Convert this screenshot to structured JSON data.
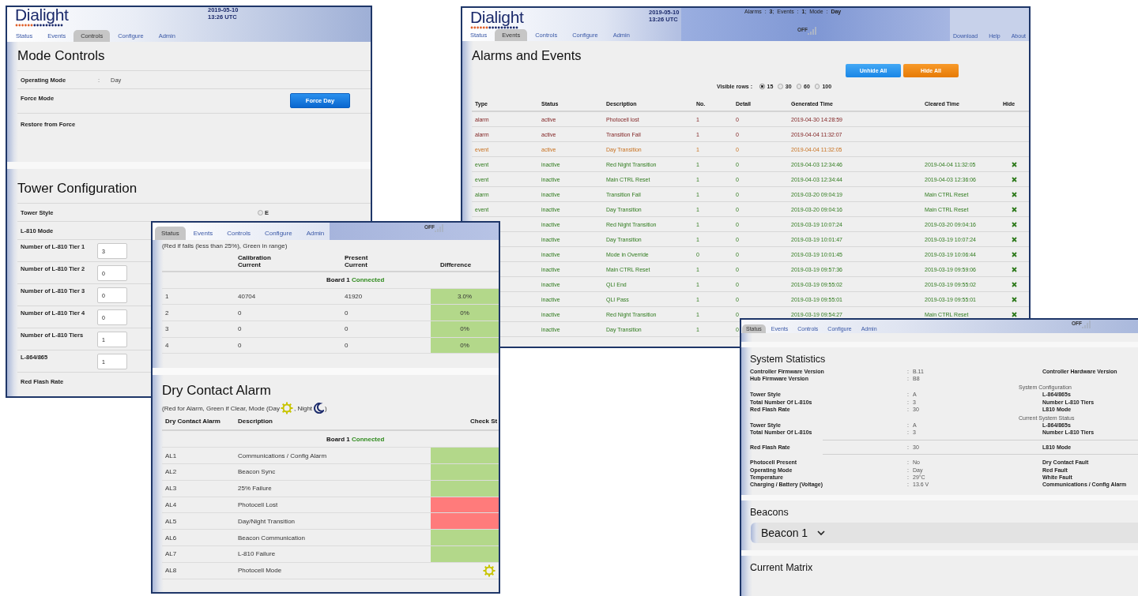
{
  "controls_window": {
    "logo": "Dialight",
    "date": "2019-05-10",
    "time": "13:26  UTC",
    "tabs": [
      {
        "label": "Status",
        "selected": false
      },
      {
        "label": "Events",
        "selected": false
      },
      {
        "label": "Controls",
        "selected": true
      },
      {
        "label": "Configure",
        "selected": false
      },
      {
        "label": "Admin",
        "selected": false
      }
    ],
    "mode_controls": {
      "title": "Mode Controls",
      "rows": [
        {
          "kind": "value",
          "label": "Operating Mode",
          "colon": ":",
          "value": "Day"
        },
        {
          "kind": "button",
          "label": "Force Mode",
          "button": "Force Day"
        },
        {
          "kind": "plain",
          "label": "Restore from Force"
        }
      ]
    },
    "tower_configuration": {
      "title": "Tower Configuration",
      "rows": [
        {
          "kind": "radio",
          "label": "Tower Style",
          "option": "E",
          "selected": false
        },
        {
          "kind": "plain",
          "label": "L-810 Mode"
        },
        {
          "kind": "input",
          "label": "Number of L-810 Tier 1",
          "value": "3"
        },
        {
          "kind": "input",
          "label": "Number of L-810 Tier 2",
          "value": "0"
        },
        {
          "kind": "input",
          "label": "Number of L-810 Tier 3",
          "value": "0"
        },
        {
          "kind": "input",
          "label": "Number of L-810 Tier 4",
          "value": "0"
        },
        {
          "kind": "input",
          "label": "Number of L-810 Tiers",
          "value": "1"
        },
        {
          "kind": "input",
          "label": "L-864/865",
          "value": "1"
        },
        {
          "kind": "plain",
          "label": "Red Flash Rate"
        }
      ]
    }
  },
  "events_window": {
    "logo": "Dialight",
    "date": "2019-05-10",
    "time": "13:26  UTC",
    "summary": "Alarms  :  **3**;  Events  :  **1**;  Mode  :  **Day**",
    "signal_label": "OFF",
    "tabs": [
      {
        "label": "Status",
        "selected": false
      },
      {
        "label": "Events",
        "selected": true
      },
      {
        "label": "Controls",
        "selected": false
      },
      {
        "label": "Configure",
        "selected": false
      },
      {
        "label": "Admin",
        "selected": false
      }
    ],
    "links": [
      "Download",
      "Help",
      "About"
    ],
    "title": "Alarms and Events",
    "buttons": [
      {
        "kind": "unhide",
        "label": "Unhide All"
      },
      {
        "kind": "hide",
        "label": "Hide All"
      }
    ],
    "visible_rows": {
      "label": "Visible rows :",
      "options": [
        {
          "label": "15",
          "selected": true
        },
        {
          "label": "30",
          "selected": false
        },
        {
          "label": "60",
          "selected": false
        },
        {
          "label": "100",
          "selected": false
        }
      ]
    },
    "table": {
      "columns": [
        "Type",
        "Status",
        "Description",
        "No.",
        "Detail",
        "Generated Time",
        "Cleared Time",
        "Hide"
      ],
      "rows": [
        {
          "type": "alarm",
          "status": "active",
          "description": "Photocell lost",
          "no": "1",
          "detail": "0",
          "generated": "2019-04-30 14:28:59",
          "hideable": false
        },
        {
          "type": "alarm",
          "status": "active",
          "description": "Transition Fail",
          "no": "1",
          "detail": "0",
          "generated": "2019-04-04 11:32:07",
          "hideable": false
        },
        {
          "type": "event",
          "status": "active",
          "description": "Day Transition",
          "no": "1",
          "detail": "0",
          "generated": "2019-04-04 11:32:05",
          "hideable": false
        },
        {
          "type": "event",
          "status": "inactive",
          "description": "Red Night Transition",
          "no": "1",
          "detail": "0",
          "generated": "2019-04-03 12:34:46",
          "cleared": "2019-04-04 11:32:05",
          "hideable": true
        },
        {
          "type": "event",
          "status": "inactive",
          "description": "Main CTRL Reset",
          "no": "1",
          "detail": "0",
          "generated": "2019-04-03 12:34:44",
          "cleared": "2019-04-03 12:36:06",
          "hideable": true
        },
        {
          "type": "alarm",
          "status": "inactive",
          "description": "Transition Fail",
          "no": "1",
          "detail": "0",
          "generated": "2019-03-20 09:04:19",
          "cleared": "Main CTRL Reset",
          "hideable": true
        },
        {
          "type": "event",
          "status": "inactive",
          "description": "Day Transition",
          "no": "1",
          "detail": "0",
          "generated": "2019-03-20 09:04:16",
          "cleared": "Main CTRL Reset",
          "hideable": true
        },
        {
          "status": "inactive",
          "description": "Red Night Transition",
          "no": "1",
          "detail": "0",
          "generated": "2019-03-19 10:07:24",
          "cleared": "2019-03-20 09:04:16",
          "hideable": true
        },
        {
          "status": "inactive",
          "description": "Day Transition",
          "no": "1",
          "detail": "0",
          "generated": "2019-03-19 10:01:47",
          "cleared": "2019-03-19 10:07:24",
          "hideable": true
        },
        {
          "status": "inactive",
          "description": "Mode in Override",
          "no": "0",
          "detail": "0",
          "generated": "2019-03-19 10:01:45",
          "cleared": "2019-03-19 10:06:44",
          "hideable": true
        },
        {
          "status": "inactive",
          "description": "Main CTRL Reset",
          "no": "1",
          "detail": "0",
          "generated": "2019-03-19 09:57:36",
          "cleared": "2019-03-19 09:59:06",
          "hideable": true
        },
        {
          "status": "inactive",
          "description": "QLI End",
          "no": "1",
          "detail": "0",
          "generated": "2019-03-19 09:55:02",
          "cleared": "2019-03-19 09:55:02",
          "hideable": true
        },
        {
          "status": "inactive",
          "description": "QLI Pass",
          "no": "1",
          "detail": "0",
          "generated": "2019-03-19 09:55:01",
          "cleared": "2019-03-19 09:55:01",
          "hideable": true
        },
        {
          "status": "inactive",
          "description": "Red Night Transition",
          "no": "1",
          "detail": "0",
          "generated": "2019-03-19 09:54:27",
          "cleared": "Main CTRL Reset",
          "hideable": true
        },
        {
          "status": "inactive",
          "description": "Day Transition",
          "no": "1",
          "detail": "0"
        }
      ]
    }
  },
  "status_window": {
    "signal_label": "OFF",
    "tabs": [
      {
        "label": "Status",
        "selected": true
      },
      {
        "label": "Events",
        "selected": false
      },
      {
        "label": "Controls",
        "selected": false
      },
      {
        "label": "Configure",
        "selected": false
      },
      {
        "label": "Admin",
        "selected": false
      }
    ],
    "matrix": {
      "note": "(Red if fails (less than 25%), Green in range)",
      "columns": [
        "Calibration Current",
        "Present Current",
        "Difference"
      ],
      "board": {
        "label": "Board 1",
        "status": "Connected"
      },
      "rows": [
        {
          "index": "1",
          "calibration": "40704",
          "present": "41920",
          "difference": "3.0%",
          "color": "#b3d88a"
        },
        {
          "index": "2",
          "calibration": "0",
          "present": "0",
          "difference": "0%",
          "color": "#b3d88a"
        },
        {
          "index": "3",
          "calibration": "0",
          "present": "0",
          "difference": "0%",
          "color": "#b3d88a"
        },
        {
          "index": "4",
          "calibration": "0",
          "present": "0",
          "difference": "0%",
          "color": "#b3d88a"
        }
      ]
    },
    "dry_contact": {
      "title": "Dry Contact Alarm",
      "legend": [
        "(Red for Alarm, Green if Clear, Mode (Day",
        ", Night",
        ")"
      ],
      "columns": [
        "Dry Contact Alarm",
        "Description",
        "Check St"
      ],
      "board": {
        "label": "Board 1",
        "status": "Connected"
      },
      "rows": [
        {
          "kind": "status",
          "id": "AL1",
          "description": "Communications / Config Alarm",
          "color": "#b3d88a"
        },
        {
          "kind": "status",
          "id": "AL2",
          "description": "Beacon Sync",
          "color": "#b3d88a"
        },
        {
          "kind": "status",
          "id": "AL3",
          "description": "25% Failure",
          "color": "#b3d88a"
        },
        {
          "kind": "status",
          "id": "AL4",
          "description": "Photocell Lost",
          "color": "#ff7b7b"
        },
        {
          "kind": "status",
          "id": "AL5",
          "description": "Day/Night Transition",
          "color": "#ff7b7b"
        },
        {
          "kind": "status",
          "id": "AL6",
          "description": "Beacon Communication",
          "color": "#b3d88a"
        },
        {
          "kind": "status",
          "id": "AL7",
          "description": "L-810 Failure",
          "color": "#b3d88a"
        },
        {
          "kind": "day_mode",
          "id": "AL8",
          "description": "Photocell Mode"
        }
      ]
    }
  },
  "statistics_window": {
    "signal_label": "OFF",
    "tabs": [
      {
        "label": "Status",
        "selected": true
      },
      {
        "label": "Events",
        "selected": false
      },
      {
        "label": "Controls",
        "selected": false
      },
      {
        "label": "Configure",
        "selected": false
      },
      {
        "label": "Admin",
        "selected": false
      }
    ],
    "title": "System Statistics",
    "groups": [
      {
        "ruled": false,
        "rows": [
          {
            "label": "Controller Firmware Version",
            "colon": ":",
            "value": "B.11",
            "right_label": "Controller Hardware Version"
          },
          {
            "label": "Hub Firmware Version",
            "colon": ":",
            "value": "B8"
          }
        ]
      },
      {
        "heading": "System Configuration",
        "ruled": false,
        "rows": [
          {
            "label": "Tower Style",
            "colon": ":",
            "value": "A",
            "right_label": "L-864/865s"
          },
          {
            "label": "Total Number Of L-810s",
            "colon": ":",
            "value": "3",
            "right_label": "Number L-810 Tiers"
          },
          {
            "label": "Red Flash Rate",
            "colon": ":",
            "value": "30",
            "right_label": "L810 Mode"
          }
        ]
      },
      {
        "heading": "Current System Status",
        "ruled": false,
        "rows": [
          {
            "label": "Tower Style",
            "colon": ":",
            "value": "A",
            "right_label": "L-864/865s"
          },
          {
            "label": "Total Number Of L-810s",
            "colon": ":",
            "value": "3",
            "right_label": "Number L-810 Tiers"
          }
        ]
      },
      {
        "ruled": true,
        "rows": [
          {
            "label": "Red Flash Rate",
            "colon": ":",
            "value": "30",
            "right_label": "L810 Mode"
          }
        ]
      },
      {
        "ruled": false,
        "rows": [
          {
            "label": "Photocell Present",
            "colon": ":",
            "value": "No",
            "right_label": "Dry Contact Fault"
          },
          {
            "label": "Operating Mode",
            "colon": ":",
            "value": "Day",
            "right_label": "Red Fault"
          },
          {
            "label": "Temperature",
            "colon": ":",
            "value": "29°C",
            "right_label": "White Fault"
          },
          {
            "label": "Charging / Battery (Voltage)",
            "colon": ":",
            "value": "13.6 V",
            "right_label": "Communications / Config Alarm"
          }
        ]
      }
    ],
    "beacons": {
      "title": "Beacons",
      "items": [
        {
          "label": "Beacon 1",
          "expanded": false
        }
      ]
    },
    "current_matrix": {
      "title": "Current Matrix"
    }
  }
}
